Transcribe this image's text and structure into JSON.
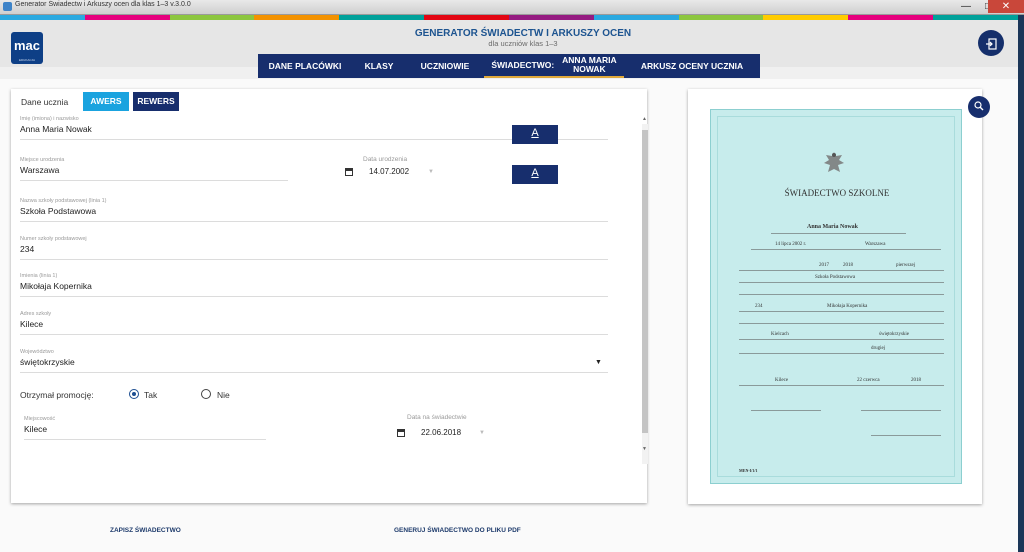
{
  "window": {
    "title": "Generator Świadectw i Arkuszy ocen dla klas 1–3 v.3.0.0",
    "controls": {
      "minimize": "—",
      "maximize": "□",
      "close": "✕"
    }
  },
  "colors": {
    "navy": "#172e6d",
    "brand_blue": "#1d5490",
    "awers_active": "#1aa3df",
    "accent": "#e0a93b",
    "colorbar": [
      "#2aa9e0",
      "#e6007e",
      "#8cc63f",
      "#f39200",
      "#00a19a",
      "#e30613",
      "#951b81",
      "#2aa9e0",
      "#8cc63f",
      "#ffcc00",
      "#e6007e",
      "#00a19a"
    ]
  },
  "header": {
    "logo_text": "mac",
    "logo_sub": "EDUKACJA",
    "app_title": "GENERATOR ŚWIADECTW I ARKUSZY OCEN",
    "app_subtitle": "dla uczniów klas 1–3",
    "exit_icon": "logout-icon"
  },
  "nav": {
    "tabs": [
      {
        "label": "DANE PLACÓWKI",
        "active": false
      },
      {
        "label": "KLASY",
        "active": false
      },
      {
        "label": "UCZNIOWIE",
        "active": false
      },
      {
        "label": "ŚWIADECTWO:",
        "label_line1": "ANNA MARIA",
        "label_line2": "NOWAK",
        "active": true
      },
      {
        "label": "ARKUSZ OCENY UCZNIA",
        "active": false
      }
    ]
  },
  "form": {
    "section_label": "Dane ucznia",
    "awers_label": "AWERS",
    "rewers_label": "REWERS",
    "name_label": "Imię (imiona) i nazwisko",
    "name_value": "Anna Maria Nowak",
    "birthplace_label": "Miejsce urodzenia",
    "birthplace_value": "Warszawa",
    "birthdate_label": "Data urodzenia",
    "birthdate_value": "14.07.2002",
    "school_name_label": "Nazwa szkoły podstawowej (linia 1)",
    "school_name_value": "Szkoła Podstawowa",
    "school_number_label": "Numer szkoły podstawowej",
    "school_number_value": "234",
    "patron_label": "Imienia (linia 1)",
    "patron_value": "Mikołaja Kopernika",
    "address_label": "Adres szkoły",
    "address_value": "Kilece",
    "voivodeship_label": "Województwo",
    "voivodeship_value": "świętokrzyskie",
    "promotion_label": "Otrzymał promocję:",
    "promotion_yes": "Tak",
    "promotion_no": "Nie",
    "promotion_selected": "Tak",
    "place_label": "Miejscowość",
    "place_value": "Kilece",
    "cert_date_label": "Data na świadectwie",
    "cert_date_value": "22.06.2018",
    "font_button_label": "A",
    "scroll_up": "▲",
    "scroll_down": "▼"
  },
  "actions": {
    "save_label": "ZAPISZ ŚWIADECTWO",
    "pdf_label": "GENERUJ ŚWIADECTWO DO PLIKU PDF"
  },
  "preview": {
    "zoom_icon": "zoom-in-icon",
    "cert_title": "ŚWIADECTWO SZKOLNE",
    "cert_name": "Anna Maria Nowak",
    "cert_birthdate": "14 lipca 2002 r.",
    "cert_birthplace": "Warszawa",
    "cert_year_from": "2017",
    "cert_year_to": "2018",
    "cert_class": "pierwszej",
    "cert_school": "Szkoła Podstawowa",
    "cert_number": "234",
    "cert_patron": "Mikołaja Kopernika",
    "cert_city": "Kielcach",
    "cert_voivodeship": "świętokrzyskie",
    "cert_promotion_class": "drugiej",
    "cert_place": "Kilece",
    "cert_day": "22 czerwca",
    "cert_year": "2018",
    "cert_code": "MEN-I/1/1"
  }
}
